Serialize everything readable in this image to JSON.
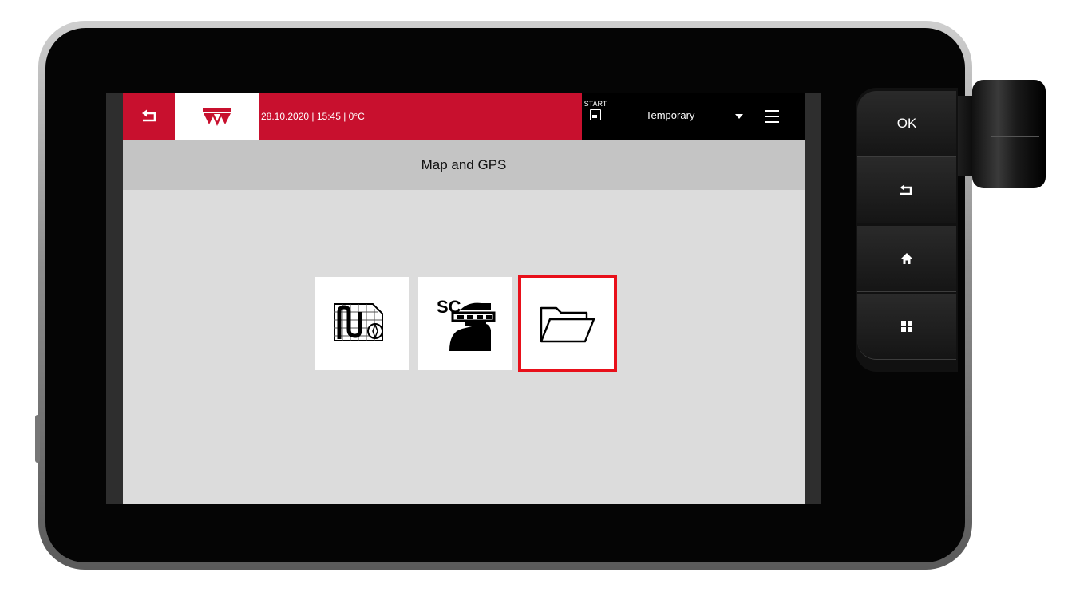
{
  "header": {
    "status_text": "28.10.2020 | 15:45 | 0°C",
    "start_label": "START",
    "profile_name": "Temporary"
  },
  "page": {
    "title": "Map and GPS"
  },
  "tiles": [
    {
      "icon": "field-map-guidance-icon"
    },
    {
      "icon": "section-control-icon",
      "label": "SC"
    },
    {
      "icon": "folder-icon",
      "selected": true
    }
  ],
  "hardware_buttons": {
    "ok_label": "OK",
    "back_icon": "back-icon",
    "home_icon": "home-icon",
    "apps_icon": "apps-icon"
  },
  "colors": {
    "brand_red": "#c8102e",
    "highlight_red": "#e8101a"
  }
}
